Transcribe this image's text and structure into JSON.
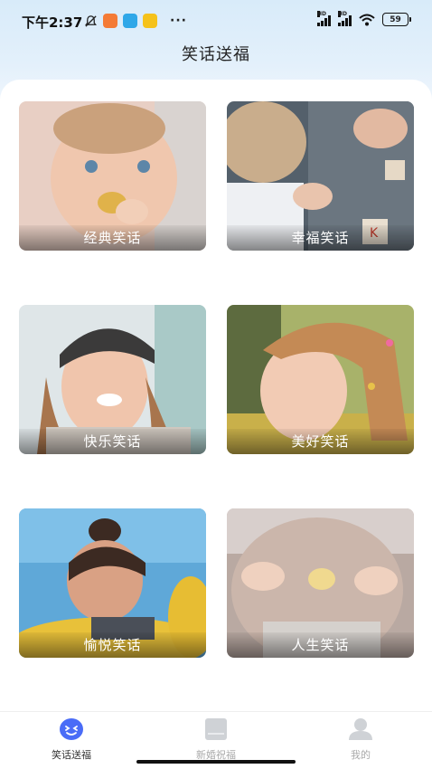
{
  "status_bar": {
    "time": "下午2:37",
    "battery": "59",
    "hd1": "HD",
    "hd2": "HD",
    "more": "···"
  },
  "header": {
    "title": "笑话送福"
  },
  "cards": [
    {
      "label": "经典笑话",
      "image": "baby-eating-photo"
    },
    {
      "label": "幸福笑话",
      "image": "toddler-playing-blocks-photo"
    },
    {
      "label": "快乐笑话",
      "image": "smiling-child-beanie-photo"
    },
    {
      "label": "美好笑话",
      "image": "girl-braided-hair-photo"
    },
    {
      "label": "愉悦笑话",
      "image": "girl-float-beach-photo"
    },
    {
      "label": "人生笑话",
      "image": "baby-hands-blurred-photo"
    }
  ],
  "tabs": [
    {
      "label": "笑话送福",
      "icon": "smiley-face-icon",
      "active": true
    },
    {
      "label": "新婚祝福",
      "icon": "card-icon",
      "active": false
    },
    {
      "label": "我的",
      "icon": "user-icon",
      "active": false
    }
  ],
  "colors": {
    "accent": "#4a6cf7",
    "bg_top": "#d8ebf9",
    "tab_inactive": "#aaaaaa"
  }
}
